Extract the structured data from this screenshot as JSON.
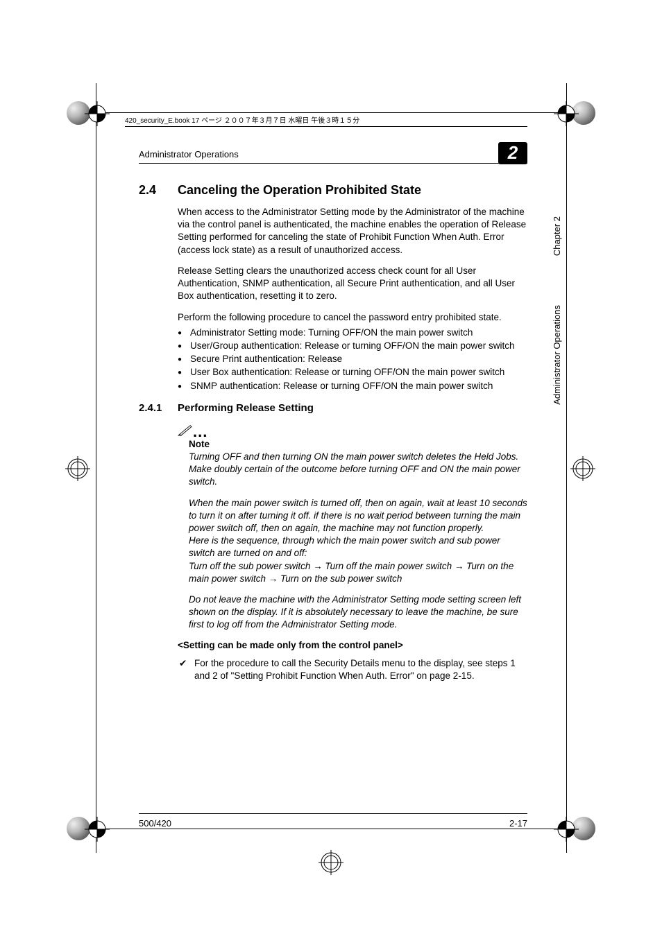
{
  "meta_line": "420_security_E.book 17 ページ ２００７年３月７日 水曜日 午後３時１５分",
  "header": {
    "section_label": "Administrator Operations",
    "chapter_badge": "2"
  },
  "side": {
    "chapter": "Chapter 2",
    "section": "Administrator Operations"
  },
  "heading": {
    "num": "2.4",
    "title": "Canceling the Operation Prohibited State"
  },
  "para1": "When access to the Administrator Setting mode by the Administrator of the machine via the control panel is authenticated, the machine enables the operation of Release Setting performed for canceling the state of Prohibit Function When Auth. Error (access lock state) as a result of unauthorized access.",
  "para2": "Release Setting clears the unauthorized access check count for all User Authentication, SNMP authentication, all Secure Print authentication, and all User Box authentication, resetting it to zero.",
  "para3": "Perform the following procedure to cancel the password entry prohibited state.",
  "bullets": [
    "Administrator Setting mode: Turning OFF/ON the main power switch",
    "User/Group authentication: Release or turning OFF/ON the main power switch",
    "Secure Print authentication: Release",
    "User Box authentication: Release or turning OFF/ON the main power switch",
    "SNMP authentication: Release or turning OFF/ON the main power switch"
  ],
  "subheading": {
    "num": "2.4.1",
    "title": "Performing Release Setting"
  },
  "note": {
    "label": "Note",
    "p1": "Turning OFF and then turning ON the main power switch deletes the Held Jobs. Make doubly certain of the outcome before turning OFF and ON the main power switch.",
    "p2": "When the main power switch is turned off, then on again, wait at least 10 seconds to turn it on after turning it off. if there is no wait period between turning the main power switch off, then on again, the machine may not function properly.",
    "p3": "Here is the sequence, through which the main power switch and sub power switch are turned on and off:",
    "p4": "Turn off the sub power switch → Turn off the main power switch → Turn on the main power switch → Turn on the sub power switch",
    "p5": "Do not leave the machine with the Administrator Setting mode setting screen left shown on the display. If it is absolutely necessary to leave the machine, be sure first to log off from the Administrator Setting mode."
  },
  "setting_heading": "<Setting can be made only from the control panel>",
  "check_text": "For the procedure to call the Security Details menu to the display, see steps 1 and 2 of \"Setting Prohibit Function When Auth. Error\" on page 2-15.",
  "footer": {
    "left": "500/420",
    "right": "2-17"
  }
}
